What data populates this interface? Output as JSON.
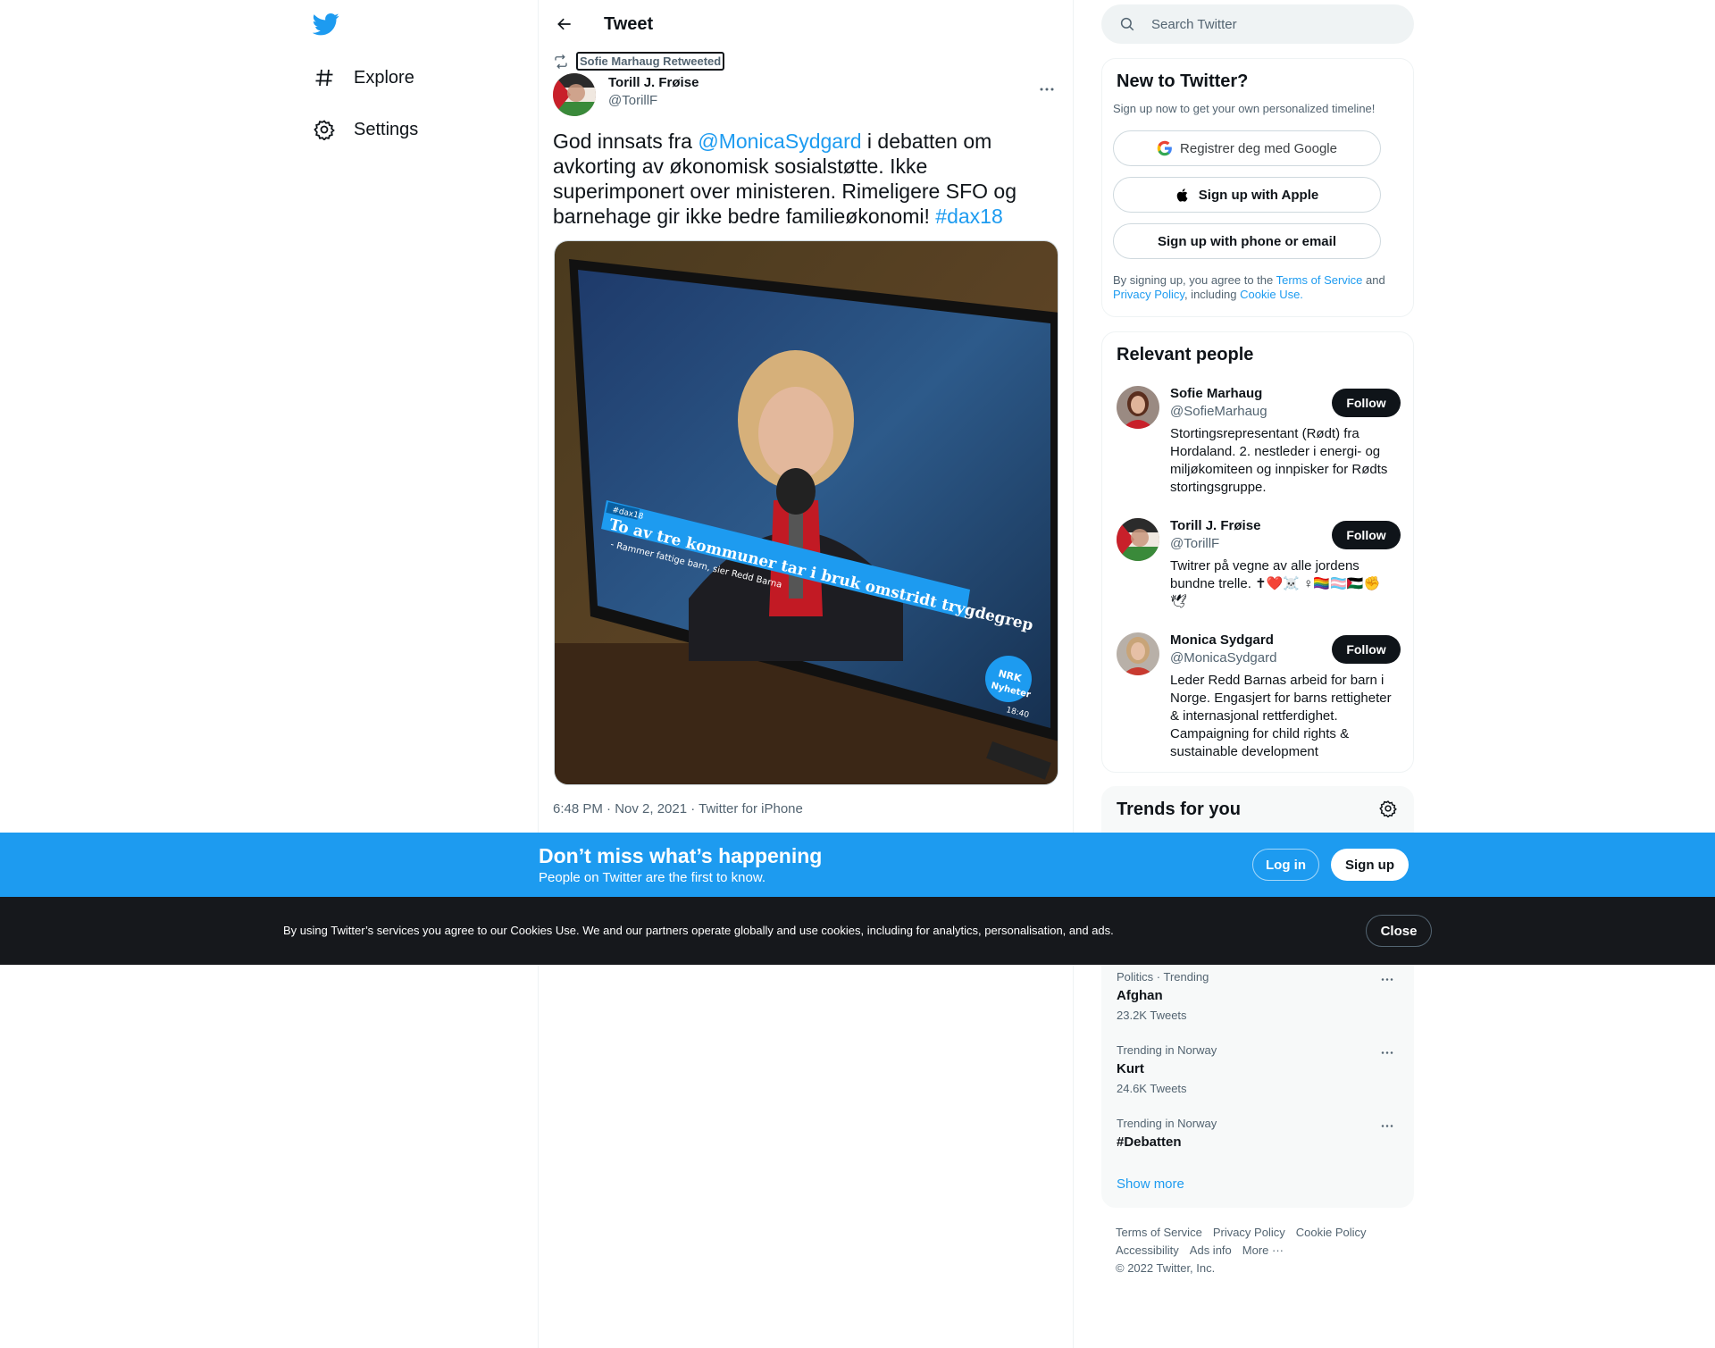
{
  "nav": {
    "explore_label": "Explore",
    "settings_label": "Settings"
  },
  "header": {
    "title": "Tweet"
  },
  "tweet": {
    "retweeted_by": "Sofie Marhaug Retweeted",
    "author_name": "Torill J. Frøise",
    "author_handle": "@TorillF",
    "text_part1": "God innsats fra ",
    "mention": "@MonicaSydgard",
    "text_part2": " i debatten om avkorting av økonomisk sosialstøtte. Ikke superimponert over ministeren. Rimeligere SFO og barnehage gir ikke bedre familieøkonomi!  ",
    "hashtag": "#dax18",
    "timestamp": "6:48 PM · Nov 2, 2021 · Twitter for iPhone",
    "media": {
      "hashtag_badge": "#dax18",
      "headline": "To av tre kommuner tar i bruk omstridt trygdegrep",
      "subline": "- Rammer fattige barn, sier Redd Barna",
      "logo_line1": "NRK",
      "logo_line2": "Nyheter",
      "clock": "18:40"
    }
  },
  "search": {
    "placeholder": "Search Twitter"
  },
  "new_to_twitter": {
    "title": "New to Twitter?",
    "subtitle": "Sign up now to get your own personalized timeline!",
    "google_button": "Registrer deg med Google",
    "apple_button": "Sign up with Apple",
    "phone_button": "Sign up with phone or email",
    "terms_prefix": "By signing up, you agree to the ",
    "terms_link": "Terms of Service",
    "terms_and": " and ",
    "privacy_link": "Privacy Policy",
    "terms_including": ", including ",
    "cookie_link": "Cookie Use."
  },
  "relevant_people": {
    "title": "Relevant people",
    "follow_label": "Follow",
    "people": [
      {
        "name": "Sofie Marhaug",
        "handle": "@SofieMarhaug",
        "bio": "Stortingsrepresentant (Rødt) fra Hordaland. 2. nestleder i energi- og miljøkomiteen og innpisker for Rødts stortingsgruppe."
      },
      {
        "name": "Torill J. Frøise",
        "handle": "@TorillF",
        "bio": "Twitrer på vegne av alle jordens bundne trelle. ✝❤️☠️ ♀🏳️‍🌈🏳️‍⚧️🇵🇸✊ 🕊"
      },
      {
        "name": "Monica Sydgard",
        "handle": "@MonicaSydgard",
        "bio": "Leder Redd Barnas arbeid for barn i Norge. Engasjert for barns rettigheter & internasjonal rettferdighet. Campaigning for child rights & sustainable development"
      }
    ]
  },
  "trends": {
    "title": "Trends for you",
    "items": [
      {
        "meta": "Politics · Trending",
        "name": "Afghan",
        "count": "23.2K Tweets"
      },
      {
        "meta": "Trending in Norway",
        "name": "Kurt",
        "count": "24.6K Tweets"
      },
      {
        "meta": "Trending in Norway",
        "name": "#Debatten",
        "count": ""
      }
    ],
    "show_more": "Show more"
  },
  "footer": {
    "links": [
      "Terms of Service",
      "Privacy Policy",
      "Cookie Policy",
      "Accessibility",
      "Ads info",
      "More ···"
    ],
    "copyright": "© 2022 Twitter, Inc."
  },
  "banner": {
    "title": "Don’t miss what’s happening",
    "subtitle": "People on Twitter are the first to know.",
    "login": "Log in",
    "signup": "Sign up"
  },
  "cookie": {
    "text": "By using Twitter’s services you agree to our Cookies Use. We and our partners operate globally and use cookies, including for analytics, personalisation, and ads.",
    "close": "Close"
  },
  "colors": {
    "twitter_blue": "#1d9bf0",
    "text_primary": "#0f1419",
    "text_secondary": "#536471",
    "cookie_bar": "#16181c"
  }
}
